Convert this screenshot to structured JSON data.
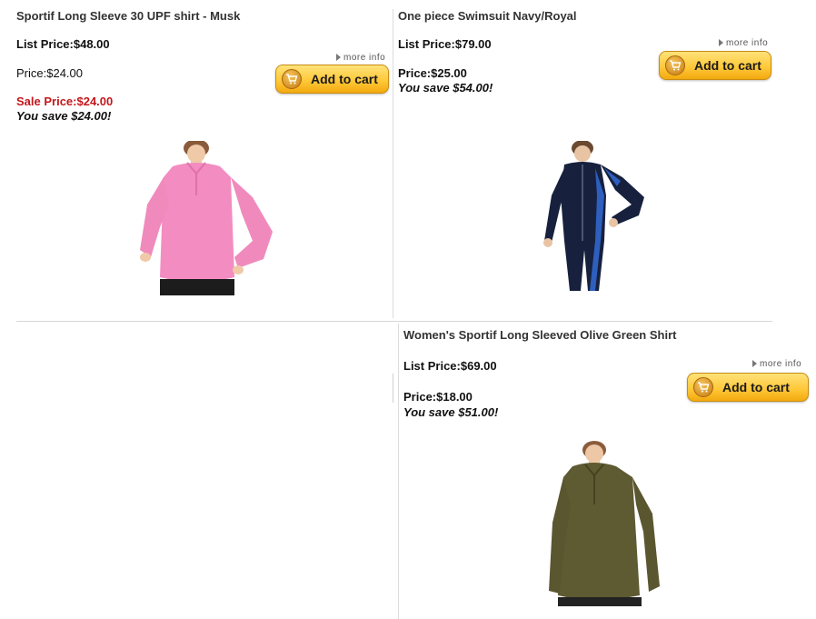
{
  "products": [
    {
      "title": "Sportif Long Sleeve 30 UPF shirt - Musk",
      "list_price": "List Price:$48.00",
      "price": "Price:$24.00",
      "sale_price": "Sale Price:$24.00",
      "you_save": "You save $24.00!",
      "more_info": "more info",
      "add_to_cart": "Add to cart",
      "image_color": "#f38cc0"
    },
    {
      "title": "One piece Swimsuit Navy/Royal",
      "list_price": "List Price:$79.00",
      "price": "Price:$25.00",
      "you_save": "You save $54.00!",
      "more_info": "more info",
      "add_to_cart": "Add to cart",
      "image_color": "#17213d",
      "accent_color": "#2e5fbf"
    },
    {
      "title": "Women's Sportif Long Sleeved Olive Green Shirt",
      "list_price": "List Price:$69.00",
      "price": "Price:$18.00",
      "you_save": "You save $51.00!",
      "more_info": "more info",
      "add_to_cart": "Add to cart",
      "image_color": "#5e5a32"
    }
  ],
  "colors": {
    "sale_red": "#c4161c",
    "button_yellow": "#ffc93a",
    "divider": "#dcdcdc"
  }
}
